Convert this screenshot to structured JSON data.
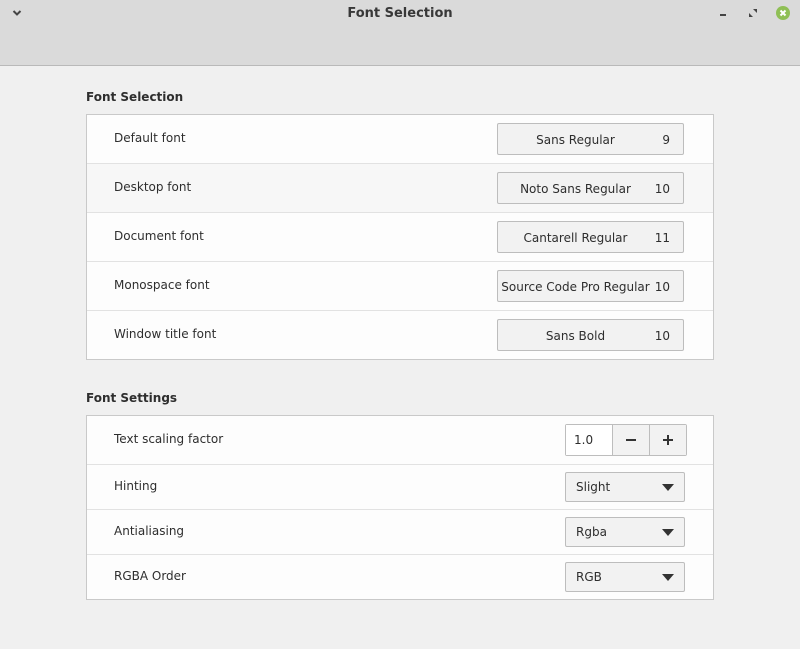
{
  "window": {
    "title": "Font Selection",
    "menu_icon": "chevron-down-icon",
    "minimize_icon": "minimize-icon",
    "maximize_icon": "maximize-icon",
    "close_icon": "close-icon",
    "close_color": "#8fbf55"
  },
  "font_selection": {
    "title": "Font Selection",
    "rows": [
      {
        "label": "Default font",
        "font": "Sans Regular",
        "size": "9"
      },
      {
        "label": "Desktop font",
        "font": "Noto Sans Regular",
        "size": "10"
      },
      {
        "label": "Document font",
        "font": "Cantarell Regular",
        "size": "11"
      },
      {
        "label": "Monospace font",
        "font": "Source Code Pro Regular",
        "size": "10"
      },
      {
        "label": "Window title font",
        "font": "Sans Bold",
        "size": "10"
      }
    ]
  },
  "font_settings": {
    "title": "Font Settings",
    "scaling": {
      "label": "Text scaling factor",
      "value": "1.0",
      "decrement": "−",
      "increment": "+"
    },
    "hinting": {
      "label": "Hinting",
      "value": "Slight"
    },
    "antialiasing": {
      "label": "Antialiasing",
      "value": "Rgba"
    },
    "rgba_order": {
      "label": "RGBA Order",
      "value": "RGB"
    }
  }
}
